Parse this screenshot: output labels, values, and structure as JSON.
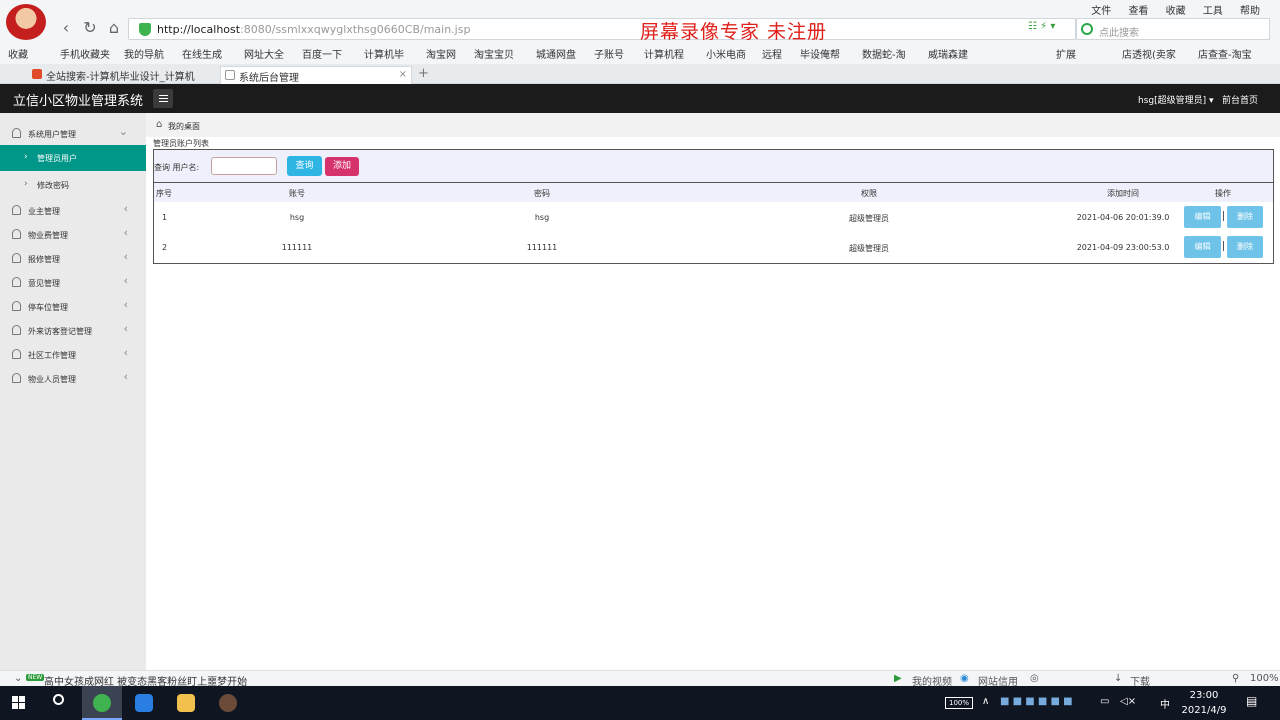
{
  "browser": {
    "url_host": "http://localhost",
    "url_rest": ":8080/ssmlxxqwyglxthsg0660CB/main.jsp",
    "watermark": "屏幕录像专家  未注册",
    "search_placeholder": "点此搜索",
    "menu": [
      "文件",
      "查看",
      "收藏",
      "工具",
      "帮助"
    ],
    "bookmarks": [
      "收藏",
      "手机收藏夹",
      "我的导航",
      "在线生成",
      "网址大全",
      "百度一下",
      "计算机毕",
      "淘宝网",
      "淘宝宝贝",
      "城通网盘",
      "子账号",
      "计算机程",
      "小米电商",
      "远程",
      "毕设俺帮",
      "数据蛇-淘",
      "威瑞森建"
    ],
    "bookmarks_right": [
      "扩展",
      "店透视(卖家",
      "店查查-淘宝"
    ],
    "tabs": [
      {
        "label": "全站搜索-计算机毕业设计_计算机"
      },
      {
        "label": "系统后台管理"
      }
    ]
  },
  "app": {
    "title": "立信小区物业管理系统",
    "user": "hsg[超级管理员]",
    "front_link": "前台首页",
    "breadcrumb": "我的桌面",
    "section_title": "管理员账户列表"
  },
  "sidebar": {
    "group": "系统用户管理",
    "subitems": [
      "管理员用户",
      "修改密码"
    ],
    "items": [
      "业主管理",
      "物业费管理",
      "报修管理",
      "意见管理",
      "停车位管理",
      "外来访客登记管理",
      "社区工作管理",
      "物业人员管理"
    ]
  },
  "search": {
    "label": "查询 用户名:",
    "value": "",
    "query_button": "查询",
    "add_button": "添加"
  },
  "table": {
    "columns": [
      "序号",
      "账号",
      "密码",
      "权限",
      "添加时间",
      "操作"
    ],
    "rows": [
      {
        "no": "1",
        "account": "hsg",
        "password": "hsg",
        "role": "超级管理员",
        "time": "2021-04-06 20:01:39.0"
      },
      {
        "no": "2",
        "account": "111111",
        "password": "111111",
        "role": "超级管理员",
        "time": "2021-04-09 23:00:53.0"
      }
    ],
    "edit_label": "编辑",
    "delete_label": "删除"
  },
  "statusbar": {
    "news": "高中女孩成网红 被变态黑客粉丝盯上噩梦开始",
    "news_badge": "NEW",
    "items": [
      "我的视频",
      "网站信用",
      "下载",
      "100%"
    ]
  },
  "taskbar": {
    "battery": "100%",
    "ime": "中",
    "time": "23:00",
    "date": "2021/4/9"
  }
}
